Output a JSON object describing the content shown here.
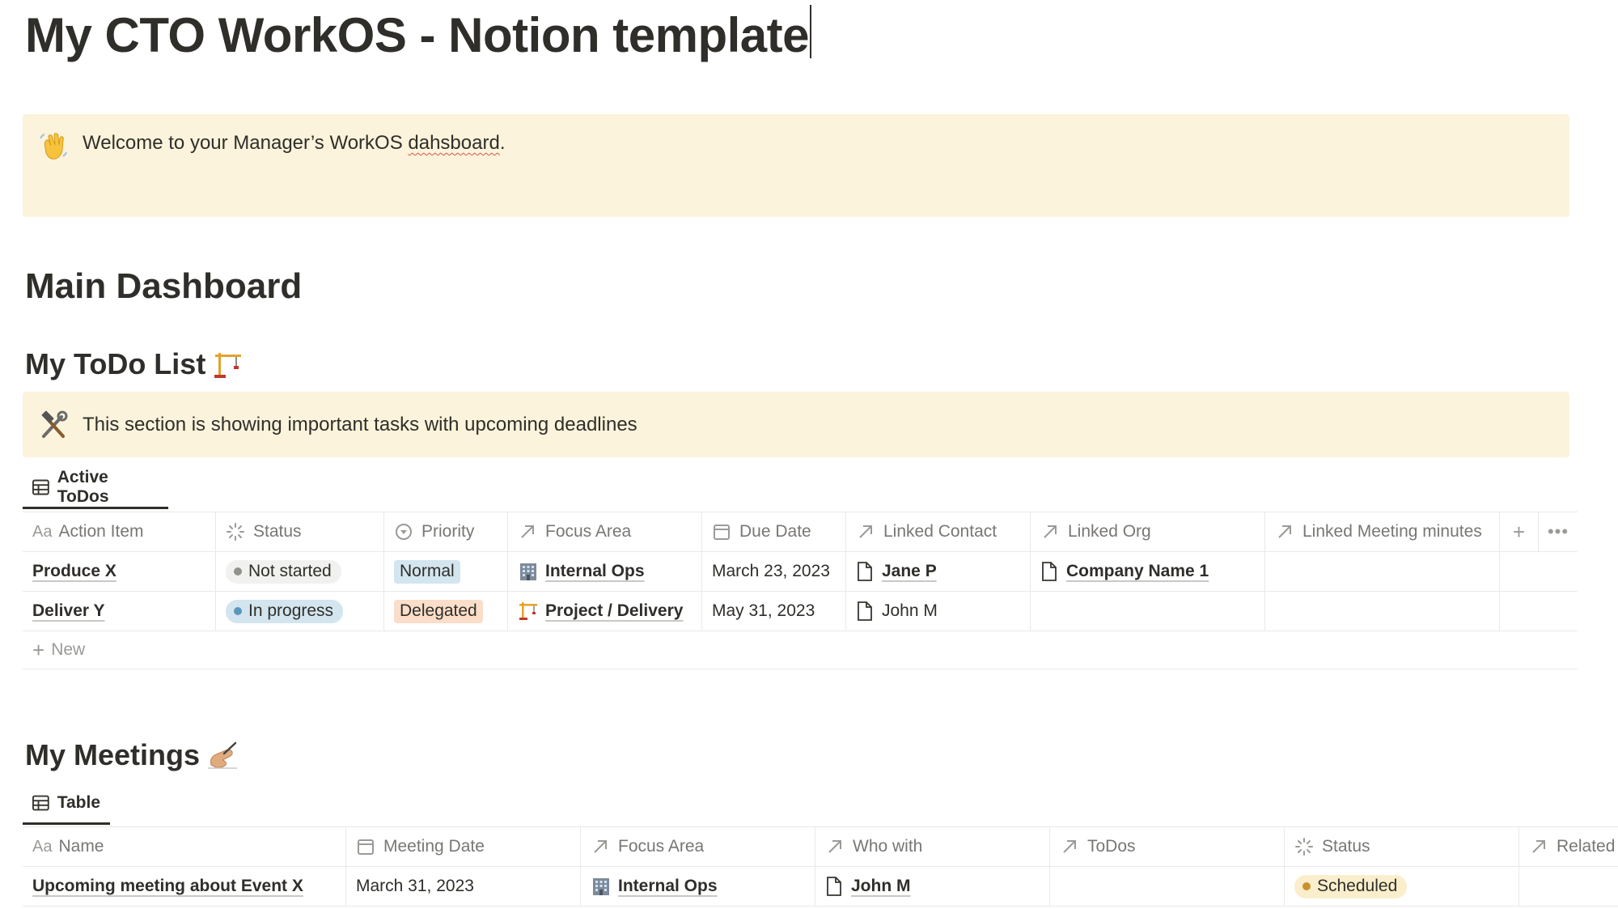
{
  "page": {
    "title": "My CTO WorkOS - Notion template"
  },
  "welcome_callout": {
    "icon": "waving-hand-emoji",
    "text_before": "Welcome to your Manager’s WorkOS ",
    "text_misspelled": "dahsboard",
    "text_after": "."
  },
  "main_heading": "Main Dashboard",
  "todo_section": {
    "heading": "My ToDo List",
    "heading_icon": "construction-crane-emoji",
    "callout_icon": "hammer-and-wrench-emoji",
    "callout_text": "This section is showing important tasks with upcoming deadlines",
    "view_tab": "Active ToDos",
    "columns": [
      "Action Item",
      "Status",
      "Priority",
      "Focus Area",
      "Due Date",
      "Linked Contact",
      "Linked Org",
      "Linked Meeting minutes"
    ],
    "title_prefix": "Aa",
    "rows": [
      {
        "action_item": "Produce X",
        "status": "Not started",
        "status_color": "#91918e",
        "status_bg": "#f1f1ef",
        "priority": "Normal",
        "priority_bg": "#d3e5ef",
        "focus_area": "Internal Ops",
        "focus_icon": "office-building-emoji",
        "due_date": "March 23, 2023",
        "linked_contact": "Jane P",
        "linked_org": "Company Name 1",
        "linked_meeting": ""
      },
      {
        "action_item": "Deliver Y",
        "status": "In progress",
        "status_color": "#5b97bd",
        "status_bg": "#d3e5ef",
        "priority": "Delegated",
        "priority_bg": "#fadec9",
        "focus_area": "Project / Delivery",
        "focus_icon": "construction-crane-emoji",
        "due_date": "May 31, 2023",
        "linked_contact": "John M",
        "linked_org": "",
        "linked_meeting": ""
      }
    ],
    "new_label": "New"
  },
  "meetings_section": {
    "heading": "My Meetings",
    "heading_icon": "writing-hand-emoji",
    "view_tab": "Table",
    "columns": [
      "Name",
      "Meeting Date",
      "Focus Area",
      "Who with",
      "ToDos",
      "Status",
      "Related"
    ],
    "title_prefix": "Aa",
    "rows": [
      {
        "name": "Upcoming meeting about Event X",
        "meeting_date": "March 31, 2023",
        "focus_area": "Internal Ops",
        "focus_icon": "office-building-emoji",
        "who_with": "John M",
        "todos": "",
        "status": "Scheduled",
        "status_color": "#cb912f",
        "status_bg": "#fbeecc"
      }
    ]
  },
  "colors": {
    "callout_bg": "#fbf3db",
    "border": "#e9e9e7",
    "muted_text": "#787774",
    "main_text": "#2f2e2a"
  }
}
